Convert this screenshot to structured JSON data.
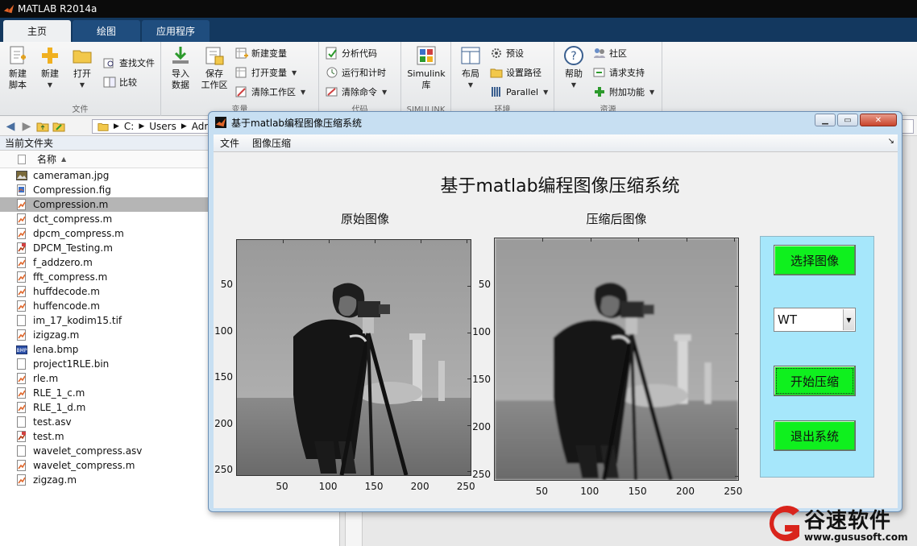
{
  "window": {
    "title": "MATLAB R2014a"
  },
  "ribbon": {
    "tabs": [
      {
        "label": "主页",
        "active": true
      },
      {
        "label": "绘图",
        "active": false
      },
      {
        "label": "应用程序",
        "active": false
      }
    ],
    "file_group": {
      "label": "文件",
      "new_script": "新建\n脚本",
      "new": "新建",
      "open": "打开",
      "find_files": "查找文件",
      "compare": "比较"
    },
    "variable_group": {
      "label": "变量",
      "import_data": "导入\n数据",
      "save_workspace": "保存\n工作区",
      "new_variable": "新建变量",
      "open_variable": "打开变量",
      "clear_workspace": "清除工作区"
    },
    "code_group": {
      "label": "代码",
      "analyze_code": "分析代码",
      "run_and_time": "运行和计时",
      "clear_commands": "清除命令"
    },
    "simulink_group": {
      "label": "SIMULINK",
      "simulink_library": "Simulink\n库"
    },
    "environment_group": {
      "label": "环境",
      "layout": "布局",
      "preferences": "预设",
      "set_path": "设置路径",
      "parallel": "Parallel"
    },
    "resources_group": {
      "label": "资源",
      "help": "帮助",
      "community": "社区",
      "request_support": "请求支持",
      "addons": "附加功能"
    }
  },
  "address": {
    "segments": [
      "C:",
      "Users",
      "Admin"
    ]
  },
  "file_panel": {
    "title": "当前文件夹",
    "column_name": "名称",
    "files": [
      {
        "name": "cameraman.jpg",
        "type": "jpg"
      },
      {
        "name": "Compression.fig",
        "type": "fig"
      },
      {
        "name": "Compression.m",
        "type": "m",
        "selected": true
      },
      {
        "name": "dct_compress.m",
        "type": "m"
      },
      {
        "name": "dpcm_compress.m",
        "type": "m"
      },
      {
        "name": "DPCM_Testing.m",
        "type": "mscript"
      },
      {
        "name": "f_addzero.m",
        "type": "m"
      },
      {
        "name": "fft_compress.m",
        "type": "m"
      },
      {
        "name": "huffdecode.m",
        "type": "m"
      },
      {
        "name": "huffencode.m",
        "type": "m"
      },
      {
        "name": "im_17_kodim15.tif",
        "type": "file"
      },
      {
        "name": "izigzag.m",
        "type": "m"
      },
      {
        "name": "lena.bmp",
        "type": "bmp"
      },
      {
        "name": "project1RLE.bin",
        "type": "file"
      },
      {
        "name": "rle.m",
        "type": "m"
      },
      {
        "name": "RLE_1_c.m",
        "type": "m"
      },
      {
        "name": "RLE_1_d.m",
        "type": "m"
      },
      {
        "name": "test.asv",
        "type": "file"
      },
      {
        "name": "test.m",
        "type": "mscript"
      },
      {
        "name": "wavelet_compress.asv",
        "type": "file"
      },
      {
        "name": "wavelet_compress.m",
        "type": "m"
      },
      {
        "name": "zigzag.m",
        "type": "m"
      }
    ]
  },
  "figure": {
    "title": "基于matlab编程图像压缩系统",
    "menus": [
      "文件",
      "图像压缩"
    ],
    "app_title": "基于matlab编程图像压缩系统",
    "left_axes": {
      "title": "原始图像",
      "y_ticks": [
        "50",
        "100",
        "150",
        "200",
        "250"
      ],
      "x_ticks": [
        "50",
        "100",
        "150",
        "200",
        "250"
      ]
    },
    "right_axes": {
      "title": "压缩后图像",
      "y_ticks": [
        "50",
        "100",
        "150",
        "200",
        "250"
      ],
      "x_ticks": [
        "50",
        "100",
        "150",
        "200",
        "250"
      ]
    },
    "controls": {
      "select_image": "选择图像",
      "method_value": "WT",
      "start_compress": "开始压缩",
      "exit_system": "退出系统"
    }
  },
  "watermark": {
    "brand": "谷速软件",
    "url": "www.gususoft.com"
  },
  "colors": {
    "green_button": "#0ff01e",
    "control_panel": "#a6e7fb",
    "tab_strip": "#13385f"
  }
}
